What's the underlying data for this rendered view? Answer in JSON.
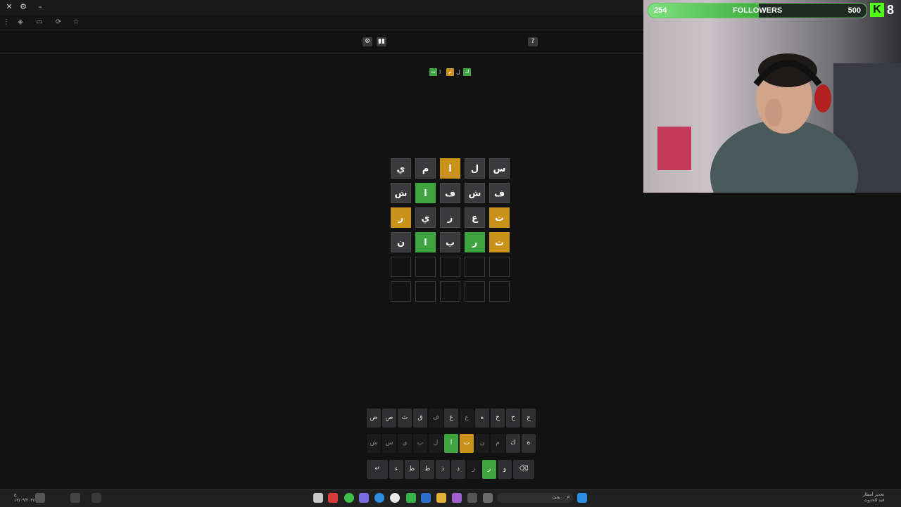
{
  "window": {
    "close_icon": "✕",
    "settings_icon": "⚙",
    "minimize_icon": "–"
  },
  "nav": {
    "icons": [
      "shield-icon",
      "reader-icon",
      "refresh-icon",
      "star-icon"
    ]
  },
  "game_header": {
    "settings_label": "⚙",
    "stats_label": "▮▮",
    "help_label": "?",
    "logo": [
      {
        "char": "ت",
        "color": "green"
      },
      {
        "char": "ا",
        "color": "none"
      },
      {
        "char": "م",
        "color": "yellow"
      },
      {
        "char": "ل",
        "color": "none"
      },
      {
        "char": "ك",
        "color": "green"
      }
    ]
  },
  "board": {
    "rows": [
      [
        {
          "l": "ي",
          "s": "gray"
        },
        {
          "l": "م",
          "s": "gray"
        },
        {
          "l": "ا",
          "s": "yellow"
        },
        {
          "l": "ل",
          "s": "gray"
        },
        {
          "l": "س",
          "s": "gray"
        }
      ],
      [
        {
          "l": "ش",
          "s": "gray"
        },
        {
          "l": "ا",
          "s": "green"
        },
        {
          "l": "ف",
          "s": "gray"
        },
        {
          "l": "ش",
          "s": "gray"
        },
        {
          "l": "ف",
          "s": "gray"
        }
      ],
      [
        {
          "l": "ر",
          "s": "yellow"
        },
        {
          "l": "ي",
          "s": "gray"
        },
        {
          "l": "ز",
          "s": "gray"
        },
        {
          "l": "ع",
          "s": "gray"
        },
        {
          "l": "ت",
          "s": "yellow"
        }
      ],
      [
        {
          "l": "ن",
          "s": "gray"
        },
        {
          "l": "ا",
          "s": "green"
        },
        {
          "l": "ب",
          "s": "gray"
        },
        {
          "l": "ر",
          "s": "green"
        },
        {
          "l": "ت",
          "s": "yellow"
        }
      ],
      [
        {
          "l": "",
          "s": "empty"
        },
        {
          "l": "",
          "s": "empty"
        },
        {
          "l": "",
          "s": "empty"
        },
        {
          "l": "",
          "s": "empty"
        },
        {
          "l": "",
          "s": "empty"
        }
      ],
      [
        {
          "l": "",
          "s": "empty"
        },
        {
          "l": "",
          "s": "empty"
        },
        {
          "l": "",
          "s": "empty"
        },
        {
          "l": "",
          "s": "empty"
        },
        {
          "l": "",
          "s": "empty"
        }
      ]
    ]
  },
  "keyboard": {
    "row1": [
      {
        "k": "ض",
        "s": "gray"
      },
      {
        "k": "ص",
        "s": "gray"
      },
      {
        "k": "ث",
        "s": "gray"
      },
      {
        "k": "ق",
        "s": "gray"
      },
      {
        "k": "ف",
        "s": "dark"
      },
      {
        "k": "غ",
        "s": "gray"
      },
      {
        "k": "ع",
        "s": "dark"
      },
      {
        "k": "ه",
        "s": "gray"
      },
      {
        "k": "خ",
        "s": "gray"
      },
      {
        "k": "ح",
        "s": "gray"
      },
      {
        "k": "ج",
        "s": "gray"
      }
    ],
    "row2": [
      {
        "k": "ش",
        "s": "dark"
      },
      {
        "k": "س",
        "s": "dark"
      },
      {
        "k": "ي",
        "s": "dark"
      },
      {
        "k": "ب",
        "s": "dark"
      },
      {
        "k": "ل",
        "s": "dark"
      },
      {
        "k": "ا",
        "s": "green"
      },
      {
        "k": "ت",
        "s": "yellow"
      },
      {
        "k": "ن",
        "s": "dark"
      },
      {
        "k": "م",
        "s": "dark"
      },
      {
        "k": "ك",
        "s": "gray"
      },
      {
        "k": "ة",
        "s": "gray"
      }
    ],
    "row3": [
      {
        "k": "↵",
        "s": "gray"
      },
      {
        "k": "ء",
        "s": "gray"
      },
      {
        "k": "ظ",
        "s": "gray"
      },
      {
        "k": "ط",
        "s": "gray"
      },
      {
        "k": "ذ",
        "s": "gray"
      },
      {
        "k": "د",
        "s": "gray"
      },
      {
        "k": "ز",
        "s": "dark"
      },
      {
        "k": "ر",
        "s": "green"
      },
      {
        "k": "و",
        "s": "gray"
      },
      {
        "k": "⌫",
        "s": "gray"
      }
    ]
  },
  "stream": {
    "followers_current": "254",
    "followers_label": "FOLLOWERS",
    "followers_goal": "500",
    "followers_progress": 0.508,
    "kick_logo": "K",
    "kick_viewers": "8"
  },
  "taskbar": {
    "search_placeholder": "بحث",
    "weather_text_1": "تحذير أمطار",
    "weather_text_2": "قيد الحدوث",
    "date_text": "١٢/٠٩/٢٠٢٤"
  },
  "colors": {
    "green": "#3fa43f",
    "yellow": "#c9921b",
    "gray": "#3a3a3c",
    "background": "#121213",
    "kick_green": "#53fc18"
  }
}
